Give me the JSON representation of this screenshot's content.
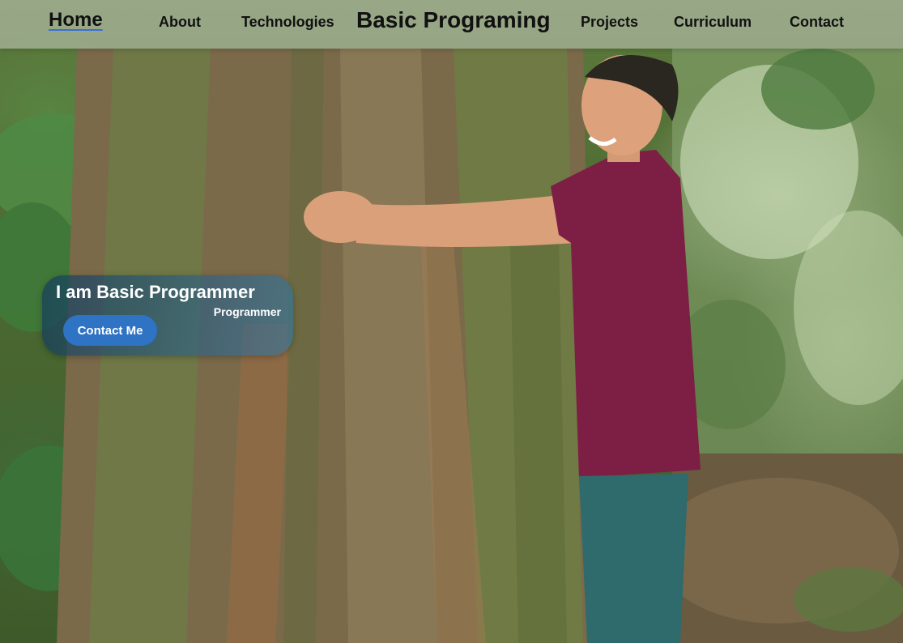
{
  "nav": {
    "home": "Home",
    "about": "About",
    "technologies": "Technologies",
    "brand": "Basic Programing",
    "projects": "Projects",
    "curriculum": "Curriculum",
    "contact": "Contact"
  },
  "hero": {
    "title": "I am Basic Programmer",
    "subtitle": "Programmer",
    "button_label": "Contact Me"
  },
  "colors": {
    "accent": "#2e73c4",
    "nav_underline": "#3a6fd8",
    "card": "#1e5a8c"
  }
}
